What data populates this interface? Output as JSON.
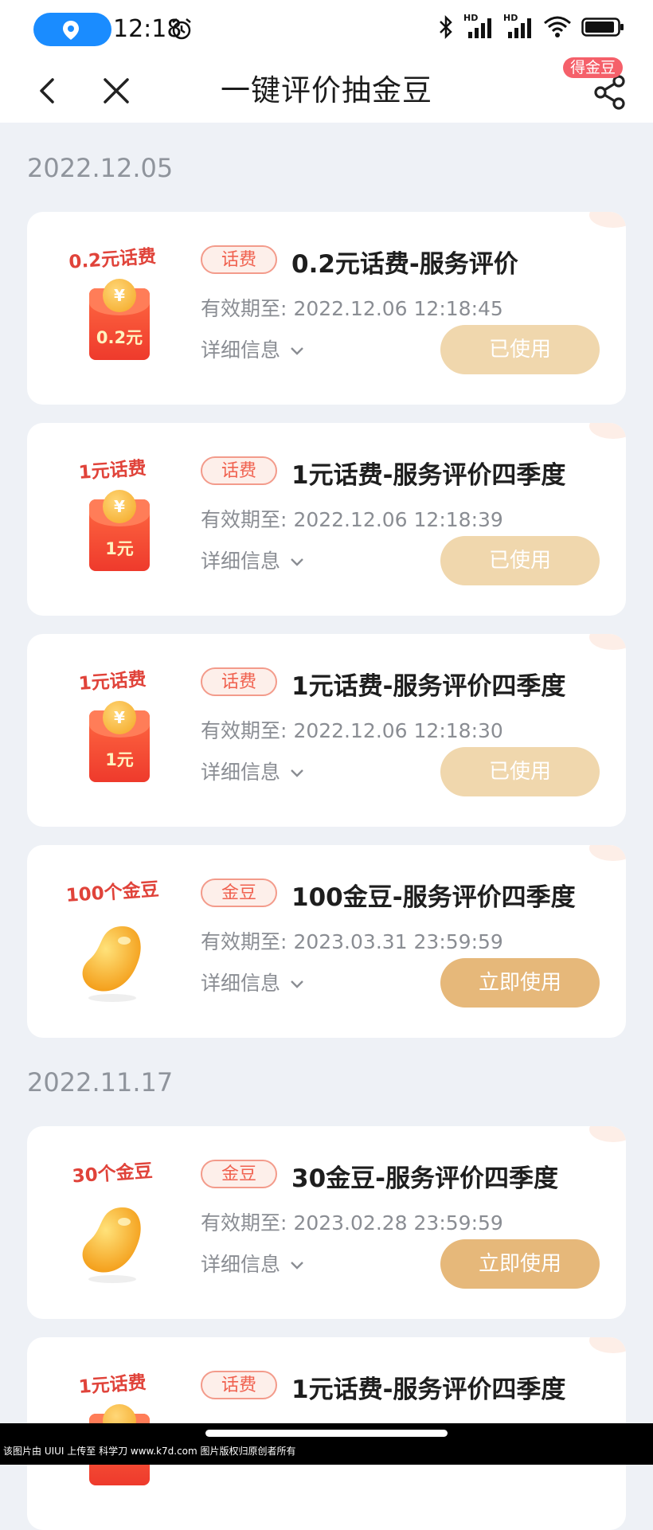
{
  "status": {
    "time": "12:18",
    "hd1": "HD",
    "hd2": "HD"
  },
  "header": {
    "title": "一键评价抽金豆",
    "badge": "得金豆"
  },
  "groups": [
    {
      "date": "2022.12.05"
    },
    {
      "date": "2022.11.17"
    }
  ],
  "validity_label": "有效期至:",
  "detail_label": "详细信息",
  "cards": [
    {
      "prize_label": "0.2元话费",
      "envelope_amount": "0.2元",
      "tag": "话费",
      "name": "0.2元话费-服务评价",
      "expiry": "2022.12.06 12:18:45",
      "button": "已使用"
    },
    {
      "prize_label": "1元话费",
      "envelope_amount": "1元",
      "tag": "话费",
      "name": "1元话费-服务评价四季度",
      "expiry": "2022.12.06 12:18:39",
      "button": "已使用"
    },
    {
      "prize_label": "1元话费",
      "envelope_amount": "1元",
      "tag": "话费",
      "name": "1元话费-服务评价四季度",
      "expiry": "2022.12.06 12:18:30",
      "button": "已使用"
    },
    {
      "prize_label": "100个金豆",
      "tag": "金豆",
      "name": "100金豆-服务评价四季度",
      "expiry": "2023.03.31 23:59:59",
      "button": "立即使用"
    },
    {
      "prize_label": "30个金豆",
      "tag": "金豆",
      "name": "30金豆-服务评价四季度",
      "expiry": "2023.02.28 23:59:59",
      "button": "立即使用"
    },
    {
      "prize_label": "1元话费",
      "tag": "话费",
      "name": "1元话费-服务评价四季度"
    }
  ],
  "coin_symbol": "¥",
  "footer": {
    "credit": "该图片由 UIUI 上传至 科学刀 www.k7d.com 图片版权归原创者所有"
  },
  "colors": {
    "brand_red": "#e0433a",
    "tag_red": "#f0614f",
    "used_button": "#f0d7ad",
    "active_button": "#e6b87a",
    "background": "#eef1f6"
  }
}
